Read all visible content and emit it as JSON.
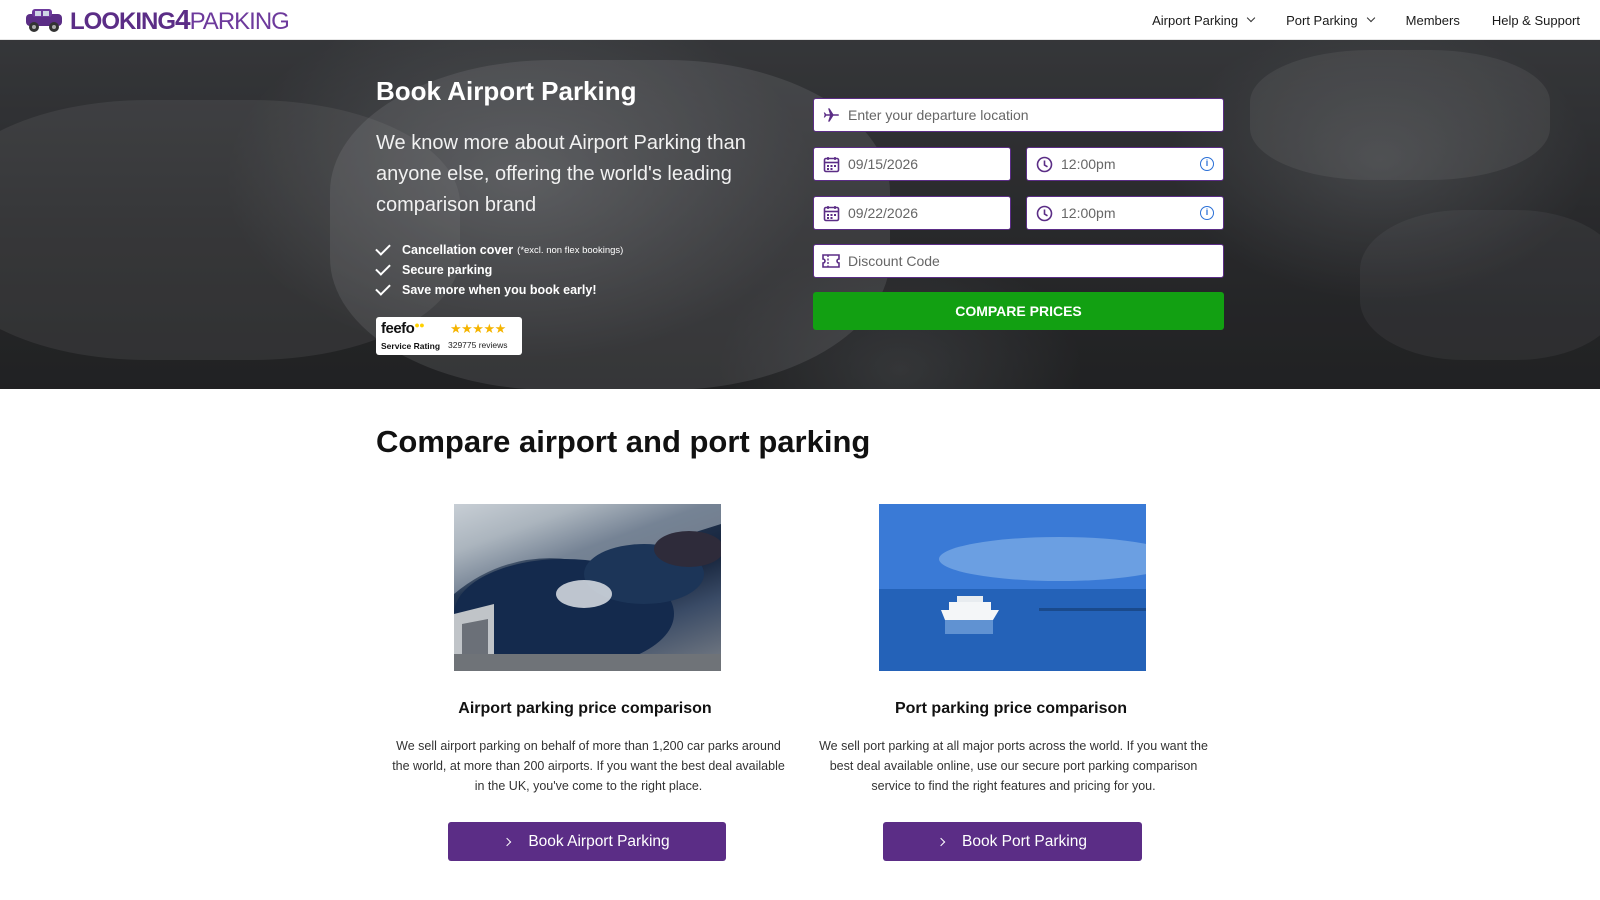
{
  "header": {
    "logo": {
      "part1": "LOOKING",
      "part2": "4",
      "part3": "PARKING"
    },
    "nav": [
      {
        "label": "Airport Parking",
        "has_dropdown": true
      },
      {
        "label": "Port Parking",
        "has_dropdown": true
      },
      {
        "label": "Members",
        "has_dropdown": false
      },
      {
        "label": "Help & Support",
        "has_dropdown": false
      }
    ]
  },
  "hero": {
    "title": "Book Airport Parking",
    "subtitle": "We know more about Airport Parking than anyone else, offering the world's leading comparison brand",
    "features": [
      {
        "text": "Cancellation cover",
        "note": "(*excl. non flex bookings)"
      },
      {
        "text": "Secure parking",
        "note": ""
      },
      {
        "text": "Save more when you book early!",
        "note": ""
      }
    ],
    "feefo": {
      "brand": "feefo",
      "label": "Service Rating",
      "stars": "★★★★★",
      "reviews": "329775 reviews"
    }
  },
  "form": {
    "departure_placeholder": "Enter your departure location",
    "drop_off_date": "09/15/2026",
    "drop_off_time": "12:00pm",
    "pick_up_date": "09/22/2026",
    "pick_up_time": "12:00pm",
    "discount_placeholder": "Discount Code",
    "submit_label": "COMPARE PRICES",
    "info_glyph": "i"
  },
  "section": {
    "title": "Compare airport and port parking",
    "cards": [
      {
        "title": "Airport parking price comparison",
        "text": "We sell airport parking on behalf of more than 1,200 car parks around the world, at more than 200 airports. If you want the best deal available in the UK, you've come to the right place.",
        "button": "Book Airport Parking"
      },
      {
        "title": "Port parking price comparison",
        "text": "We sell port parking at all major ports across the world. If you want the best deal available online, use our secure port parking comparison service to find the right features and pricing for you.",
        "button": "Book Port Parking"
      }
    ]
  },
  "colors": {
    "brand_purple": "#5b2d86",
    "cta_green": "#12a012",
    "info_blue": "#2a6fd6"
  }
}
